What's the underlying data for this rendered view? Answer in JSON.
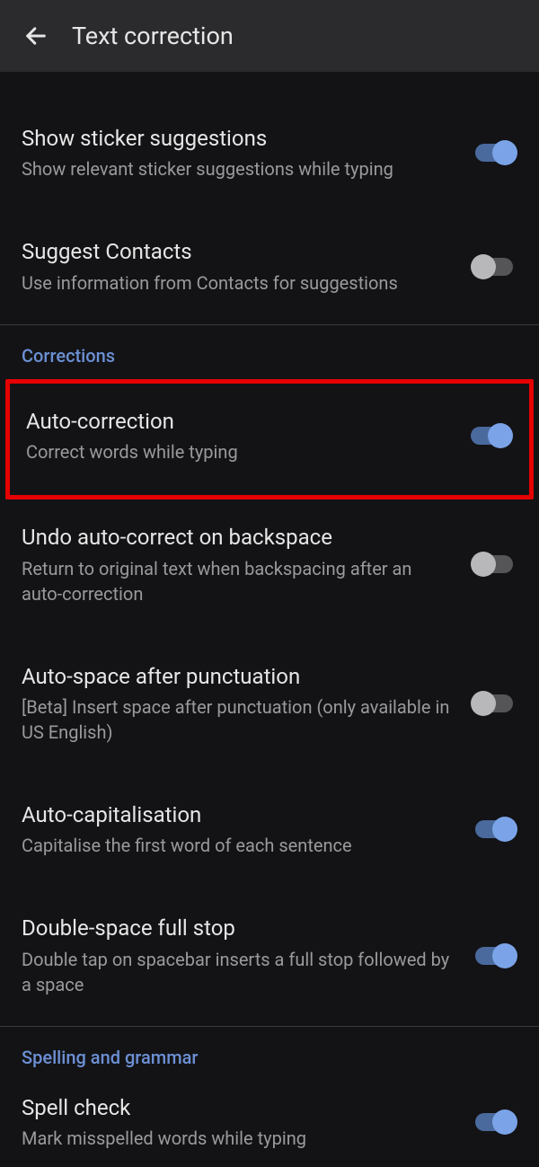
{
  "header": {
    "title": "Text correction"
  },
  "settings": {
    "sticker_suggestions": {
      "title": "Show sticker suggestions",
      "subtitle": "Show relevant sticker suggestions while typing",
      "on": true
    },
    "suggest_contacts": {
      "title": "Suggest Contacts",
      "subtitle": "Use information from Contacts for suggestions",
      "on": false
    },
    "corrections_header": "Corrections",
    "auto_correction": {
      "title": "Auto-correction",
      "subtitle": "Correct words while typing",
      "on": true
    },
    "undo_auto_correct": {
      "title": "Undo auto-correct on backspace",
      "subtitle": "Return to original text when backspacing after an auto-correction",
      "on": false
    },
    "auto_space": {
      "title": "Auto-space after punctuation",
      "subtitle": "[Beta] Insert space after punctuation (only available in US English)",
      "on": false
    },
    "auto_capitalisation": {
      "title": "Auto-capitalisation",
      "subtitle": "Capitalise the first word of each sentence",
      "on": true
    },
    "double_space": {
      "title": "Double-space full stop",
      "subtitle": "Double tap on spacebar inserts a full stop followed by a space",
      "on": true
    },
    "spelling_header": "Spelling and grammar",
    "spell_check": {
      "title": "Spell check",
      "subtitle": "Mark misspelled words while typing",
      "on": true
    }
  }
}
